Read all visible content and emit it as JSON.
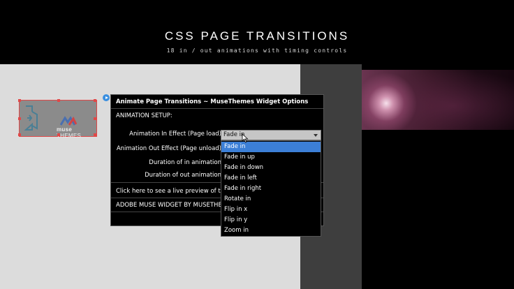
{
  "header": {
    "title": "CSS PAGE TRANSITIONS",
    "subtitle": "18 in / out animations with timing controls"
  },
  "widget_thumbnail": {
    "brand_bold": "muse",
    "brand_light": "THEMES",
    "selection_color": "#e04848"
  },
  "dialog": {
    "title": "Animate Page Transitions ~ MuseThemes Widget Options",
    "section": "ANIMATION SETUP:",
    "fields": {
      "in_effect_label": "Animation In Effect (Page load)",
      "out_effect_label": "Animation Out Effect (Page unload)",
      "duration_in_label": "Duration of in animation",
      "duration_out_label": "Duration of out animation"
    },
    "preview_link": "Click here to see a live preview of this w",
    "footer": "ADOBE MUSE WIDGET BY MUSETHEMES."
  },
  "select": {
    "value": "Fade in",
    "accent": "#3c7fd6",
    "options": [
      "Fade in",
      "Fade in up",
      "Fade in down",
      "Fade in left",
      "Fade in right",
      "Rotate in",
      "Flip in x",
      "Flip in y",
      "Zoom in"
    ],
    "selected_index": 0
  }
}
